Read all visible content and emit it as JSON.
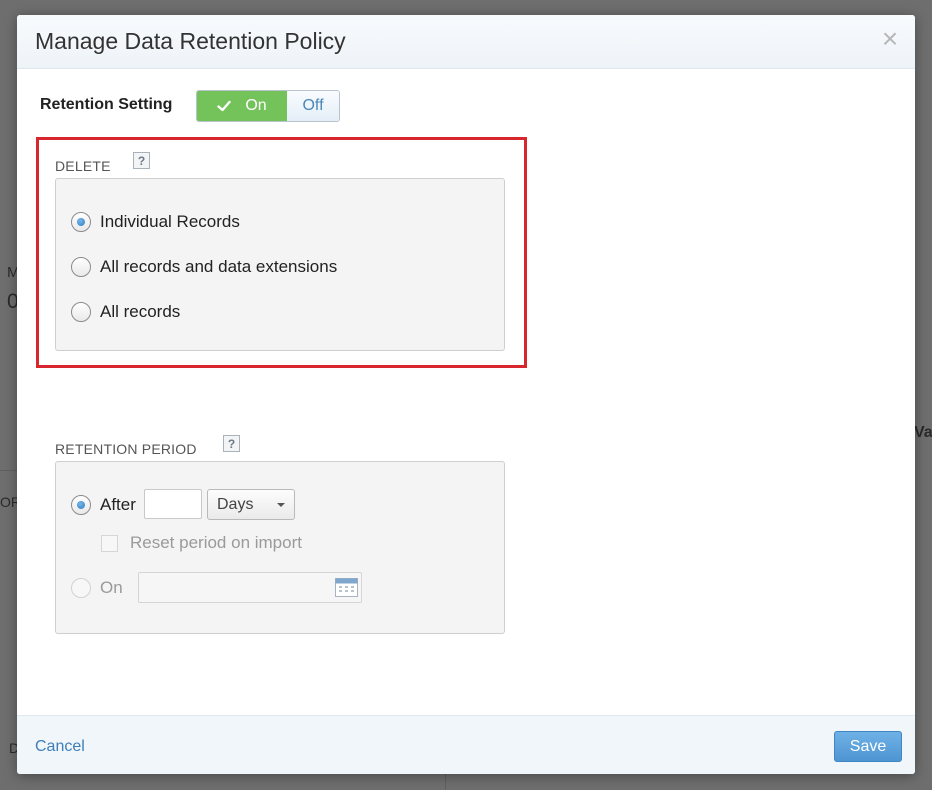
{
  "background": {
    "fragment_m": "M",
    "fragment_zero": "0",
    "fragment_or": "OR",
    "fragment_val": "Val",
    "fragment_d": "D"
  },
  "dialog": {
    "title": "Manage Data Retention Policy",
    "close_symbol": "×"
  },
  "retention_setting": {
    "label": "Retention Setting",
    "on_label": "On",
    "off_label": "Off",
    "state": "On"
  },
  "delete_section": {
    "label": "DELETE",
    "help_symbol": "?",
    "options": [
      {
        "label": "Individual Records",
        "selected": true
      },
      {
        "label": "All records and data extensions",
        "selected": false
      },
      {
        "label": "All records",
        "selected": false
      }
    ]
  },
  "retention_period": {
    "label": "RETENTION PERIOD",
    "help_symbol": "?",
    "after_label": "After",
    "after_value": "",
    "unit_selected": "Days",
    "reset_label": "Reset period on import",
    "on_label": "On",
    "on_date_value": ""
  },
  "footer": {
    "cancel_label": "Cancel",
    "save_label": "Save"
  },
  "colors": {
    "accent_blue": "#4e95d2",
    "toggle_green": "#73c25a",
    "highlight_red": "#d8262e"
  }
}
